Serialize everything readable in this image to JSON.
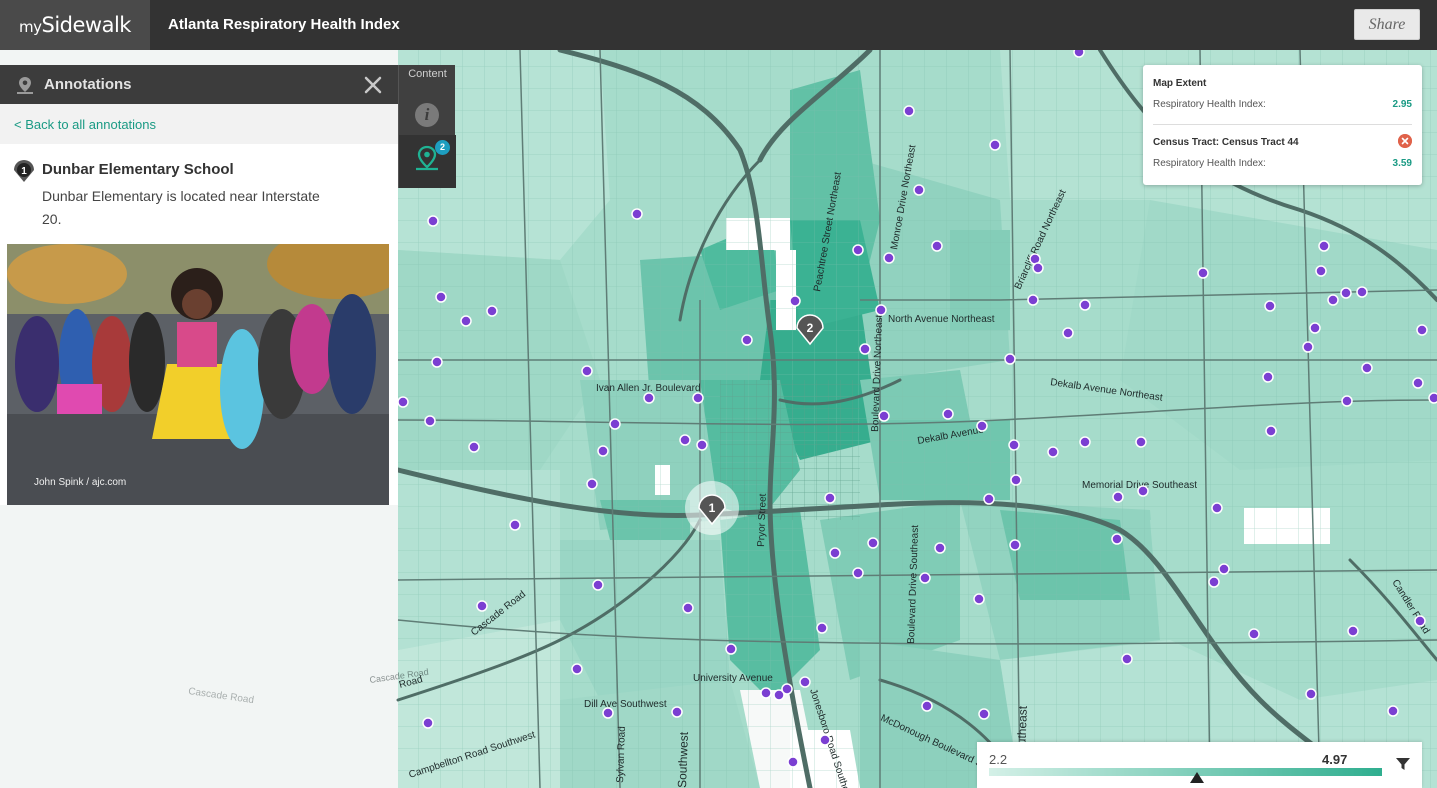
{
  "app": {
    "logo_prefix": "my",
    "logo_main": "Sidewalk",
    "title": "Atlanta Respiratory Health Index",
    "share_label": "Share"
  },
  "panel": {
    "title": "Annotations",
    "back_link": "< Back to all annotations",
    "annotation": {
      "number": "1",
      "title": "Dunbar Elementary School",
      "description": "Dunbar Elementary is located near Interstate 20.",
      "photo_credit": "John Spink / ajc.com"
    }
  },
  "content_tab": {
    "label": "Content",
    "info_icon": "i",
    "annotation_count": "2"
  },
  "info_card": {
    "section1_title": "Map Extent",
    "section1_label": "Respiratory Health Index:",
    "section1_value": "2.95",
    "section2_title": "Census Tract: Census Tract 44",
    "section2_label": "Respiratory Health Index:",
    "section2_value": "3.59"
  },
  "legend": {
    "min": "2.2",
    "max": "4.97",
    "handle_fraction": 0.7
  },
  "map": {
    "markers": [
      {
        "number": "1"
      },
      {
        "number": "2"
      }
    ],
    "road_labels": [
      "Peachtree Street Northeast",
      "Monroe Drive Northeast",
      "Briarcliff Road Northeast",
      "North Avenue Northeast",
      "Ivan Allen Jr. Boulevard",
      "Boulevard Drive Northeast",
      "Dekalb Avenue Northeast",
      "Dekalb Avenue",
      "Memorial Drive Southeast",
      "Pryor Street",
      "Boulevard Drive Southeast",
      "Cascade Road",
      "University Avenue",
      "Dill Ave Southwest",
      "Campbellton Road Southwest",
      "Sylvan Road",
      "Jonesboro Road Southeast",
      "McDonough Boulevard Southeast",
      "Candler Road",
      "Cascade Road",
      "Southeast",
      "Southwest",
      "Road"
    ]
  },
  "colors": {
    "topbar": "#333333",
    "accent": "#1a9a84",
    "map_base": "#9ad6c5",
    "map_dark": "#3fb79a",
    "point": "#7b3fd2",
    "close": "#e0624a"
  }
}
